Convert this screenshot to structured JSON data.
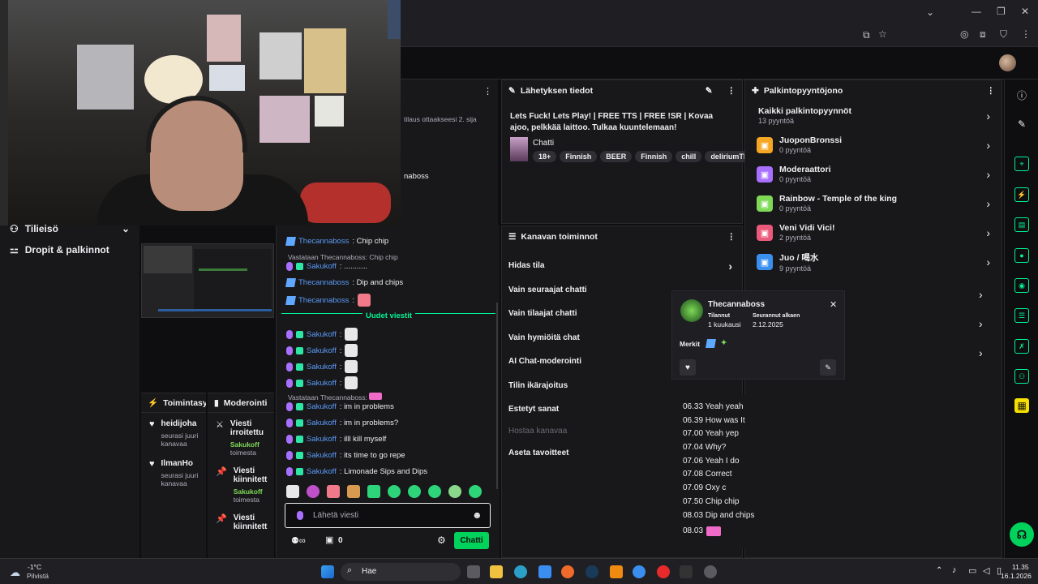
{
  "browser": {
    "window_controls": [
      "—",
      "❐",
      "✕"
    ]
  },
  "panels": {
    "stream_info": {
      "title": "Lähetyksen tiedot",
      "stream_title": "Lets Fuck! Lets Play! | FREE TTS | FREE !SR | Kovaa ajoo, pelkkää laittoo. Tulkaa kuuntelemaan!",
      "category": "Chatti",
      "tags": [
        "18+",
        "Finnish",
        "BEER",
        "Finnish",
        "chill",
        "deliriumTREME"
      ]
    },
    "rewards": {
      "title": "Palkintopyyntöjono",
      "all_label": "Kaikki palkintopyynnöt",
      "all_count": "13 pyyntöä",
      "items": [
        {
          "name": "JuoponBronssi",
          "count": "0 pyyntöä",
          "color": "#f5a623"
        },
        {
          "name": "Moderaattori",
          "count": "0 pyyntöä",
          "color": "#a970ff"
        },
        {
          "name": "Rainbow - Temple of the king",
          "count": "0 pyyntöä",
          "color": "#7ed957"
        },
        {
          "name": "Veni Vidi Vici!",
          "count": "2 pyyntöä",
          "color": "#eb5a7a"
        },
        {
          "name": "Juo / 喝水",
          "count": "9 pyyntöä",
          "color": "#3a8ef0"
        }
      ]
    },
    "channel_actions": {
      "title": "Kanavan toiminnot",
      "items": [
        "Hidas tila",
        "Vain seuraajat chatti",
        "Vain tilaajat chatti",
        "Vain hymiöitä chat",
        "AI Chat-moderointi",
        "Tilin ikärajoitus",
        "Estetyt sanat",
        "Hostaa kanavaa",
        "Aseta tavoitteet"
      ]
    },
    "left_top_snippets": {
      "tilaus": "tilaus ottaakseesi 2. sija",
      "naboss": "naboss"
    }
  },
  "sidebar": {
    "item1": "Tilieisö",
    "item2": "Dropit & palkinnot"
  },
  "activity": {
    "title": "Toimintasyöte",
    "items": [
      {
        "name": "heidijoha",
        "sub": "seurasi juuri kanavaa"
      },
      {
        "name": "IlmanHo",
        "sub": "seurasi juuri kanavaa"
      }
    ]
  },
  "moderation": {
    "title": "Moderointi",
    "items": [
      {
        "label": "Viesti irroitettu",
        "user": "Sakukoff",
        "sub": "toimesta"
      },
      {
        "label": "Viesti kiinnitett",
        "user": "Sakukoff",
        "sub": "toimesta"
      },
      {
        "label": "Viesti kiinnitett",
        "user": "",
        "sub": ""
      }
    ]
  },
  "chat": {
    "messages_top": [
      {
        "user": "Thecannaboss",
        "text": ": Chip chip"
      },
      {
        "reply": "Vastataan Thecannaboss: Chip chip"
      },
      {
        "user": "Sakukoff",
        "text": ": ..........."
      },
      {
        "user": "Thecannaboss",
        "text": ": Dip and chips"
      },
      {
        "user": "Thecannaboss",
        "text": ":"
      }
    ],
    "new_messages": "Uudet viestit",
    "messages_bottom": [
      {
        "user": "Sakukoff",
        "text": ":"
      },
      {
        "user": "Sakukoff",
        "text": ":"
      },
      {
        "user": "Sakukoff",
        "text": ":"
      },
      {
        "user": "Sakukoff",
        "text": ":"
      },
      {
        "reply": "Vastataan Thecannaboss:"
      },
      {
        "user": "Sakukoff",
        "text": ": im in problems"
      },
      {
        "user": "Sakukoff",
        "text": ": im in problems?"
      },
      {
        "user": "Sakukoff",
        "text": ": illl kill myself"
      },
      {
        "user": "Sakukoff",
        "text": ": its time to go repe"
      },
      {
        "user": "Sakukoff",
        "text": ": Limonade Sips and Dips"
      }
    ],
    "input_placeholder": "Lähetä viesti",
    "points": "0",
    "send_label": "Chatti"
  },
  "user_card": {
    "name": "Thecannaboss",
    "subscribed_label": "Tilannut",
    "subscribed_value": "1 kuukausi",
    "following_label": "Seurannut alkaen",
    "following_value": "2.12.2025",
    "badges_label": "Merkit"
  },
  "lyrics": [
    "06.33 Yeah yeah",
    "06.39 How was It",
    "07.00 Yeah yep",
    "07.04 Why?",
    "07.06 Yeah I do",
    "07.08 Correct",
    "07.09 Oxy c",
    "07.50 Chip chip",
    "08.03 Dip and chips",
    "08.03"
  ],
  "taskbar": {
    "weather_temp": "-1°C",
    "weather_desc": "Pilvistä",
    "search": "Hae",
    "time": "11.35",
    "date": "16.1.2026"
  }
}
